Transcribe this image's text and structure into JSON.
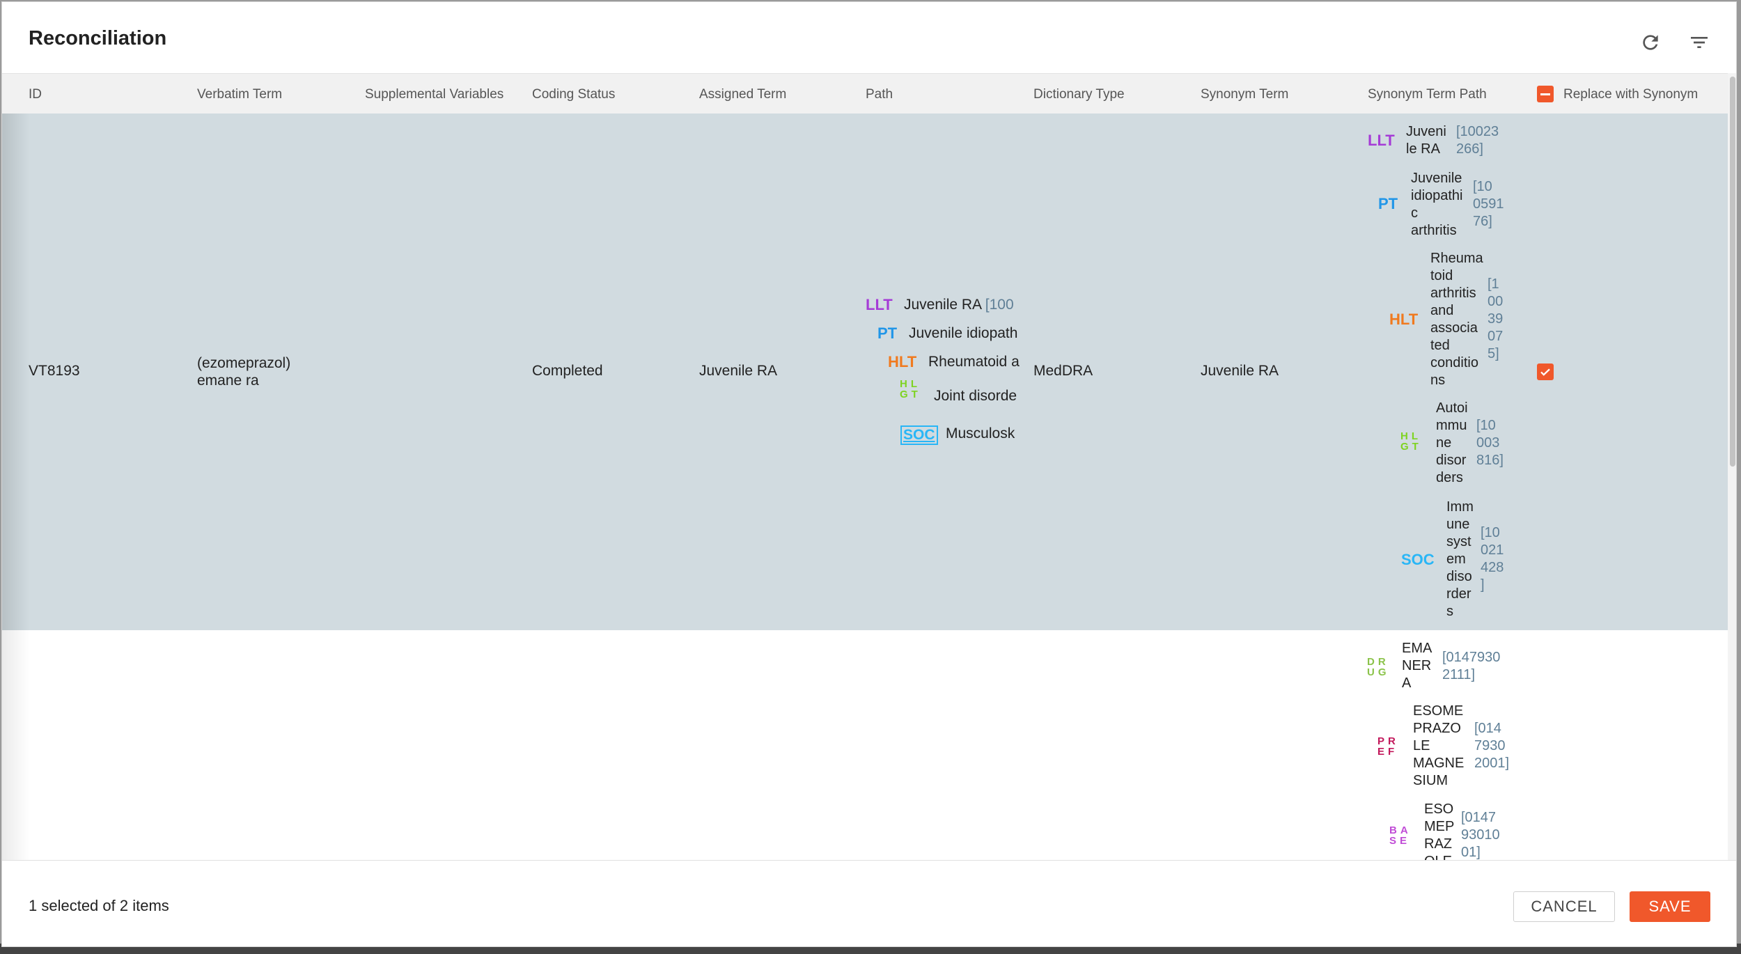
{
  "dialog": {
    "title": "Reconciliation"
  },
  "columns": [
    "ID",
    "Verbatim Term",
    "Supplemental Variables",
    "Coding Status",
    "Assigned Term",
    "Path",
    "Dictionary Type",
    "Synonym Term",
    "Synonym Term Path",
    "Replace with Synonym"
  ],
  "rows": [
    {
      "id": "VT8193",
      "verbatim_line1": "(ezomeprazol)",
      "verbatim_line2": "emane ra",
      "coding_status": "Completed",
      "assigned_term": "Juvenile RA",
      "path": [
        {
          "level": "LLT",
          "term": "Juvenile RA",
          "code": "[100"
        },
        {
          "level": "PT",
          "term": "Juvenile idiopath",
          "code": ""
        },
        {
          "level": "HLT",
          "term": "Rheumatoid a",
          "code": ""
        },
        {
          "level": "HLGT",
          "term": "Joint disorde",
          "code": ""
        },
        {
          "level": "SOC",
          "term": "Musculosk",
          "code": ""
        }
      ],
      "dictionary_type": "MedDRA",
      "synonym_term": "Juvenile RA",
      "synonym_path": [
        {
          "level": "LLT",
          "term_lines": [
            "Juveni",
            "le RA"
          ],
          "code_lines": [
            "[10023",
            "266]"
          ]
        },
        {
          "level": "PT",
          "term_lines": [
            "Juvenile",
            "idiopathi",
            "c",
            "arthritis"
          ],
          "code_lines": [
            "[10",
            "0591",
            "76]"
          ]
        },
        {
          "level": "HLT",
          "term_lines": [
            "Rheuma",
            "toid",
            "arthritis",
            "and",
            "associa",
            "ted",
            "conditio",
            "ns"
          ],
          "code_lines": [
            "[1",
            "00",
            "39",
            "07",
            "5]"
          ]
        },
        {
          "level": "HLGT",
          "term_lines": [
            "Autoi",
            "mmu",
            "ne",
            "disor",
            "ders"
          ],
          "code_lines": [
            "[10",
            "003",
            "816]"
          ]
        },
        {
          "level": "SOC",
          "term_lines": [
            "Imm",
            "une",
            "syst",
            "em",
            "diso",
            "rder",
            "s"
          ],
          "code_lines": [
            "[10",
            "021",
            "428",
            "]"
          ]
        }
      ],
      "replace_with_synonym": true
    },
    {
      "synonym_path": [
        {
          "level": "DRUG",
          "term_lines": [
            "EMA",
            "NER",
            "A"
          ],
          "code_lines": [
            "[0147930",
            "2111]"
          ]
        },
        {
          "level": "PREF",
          "term_lines": [
            "ESOME",
            "PRAZO",
            "LE",
            "MAGNE",
            "SIUM"
          ],
          "code_lines": [
            "[014",
            "7930",
            "2001]"
          ]
        },
        {
          "level": "BASE",
          "term_lines": [
            "ESO",
            "MEP",
            "RAZ",
            "OLE"
          ],
          "code_lines": [
            "[0147",
            "93010",
            "01]"
          ]
        }
      ]
    }
  ],
  "footer": {
    "status": "1 selected of 2 items",
    "cancel_label": "CANCEL",
    "save_label": "SAVE"
  },
  "icons": {
    "refresh": "refresh-icon",
    "filter": "filter-icon"
  },
  "colors": {
    "accent": "#f0582b",
    "LLT": "#a53bd6",
    "PT": "#2196e8",
    "HLT": "#f07a1f",
    "HLGT": "#7ed321",
    "SOC": "#29b6f6",
    "DRUG": "#8bc34a",
    "PREF": "#c2185b",
    "BASE": "#c04cd6",
    "selected_row": "#d1dbe0"
  }
}
